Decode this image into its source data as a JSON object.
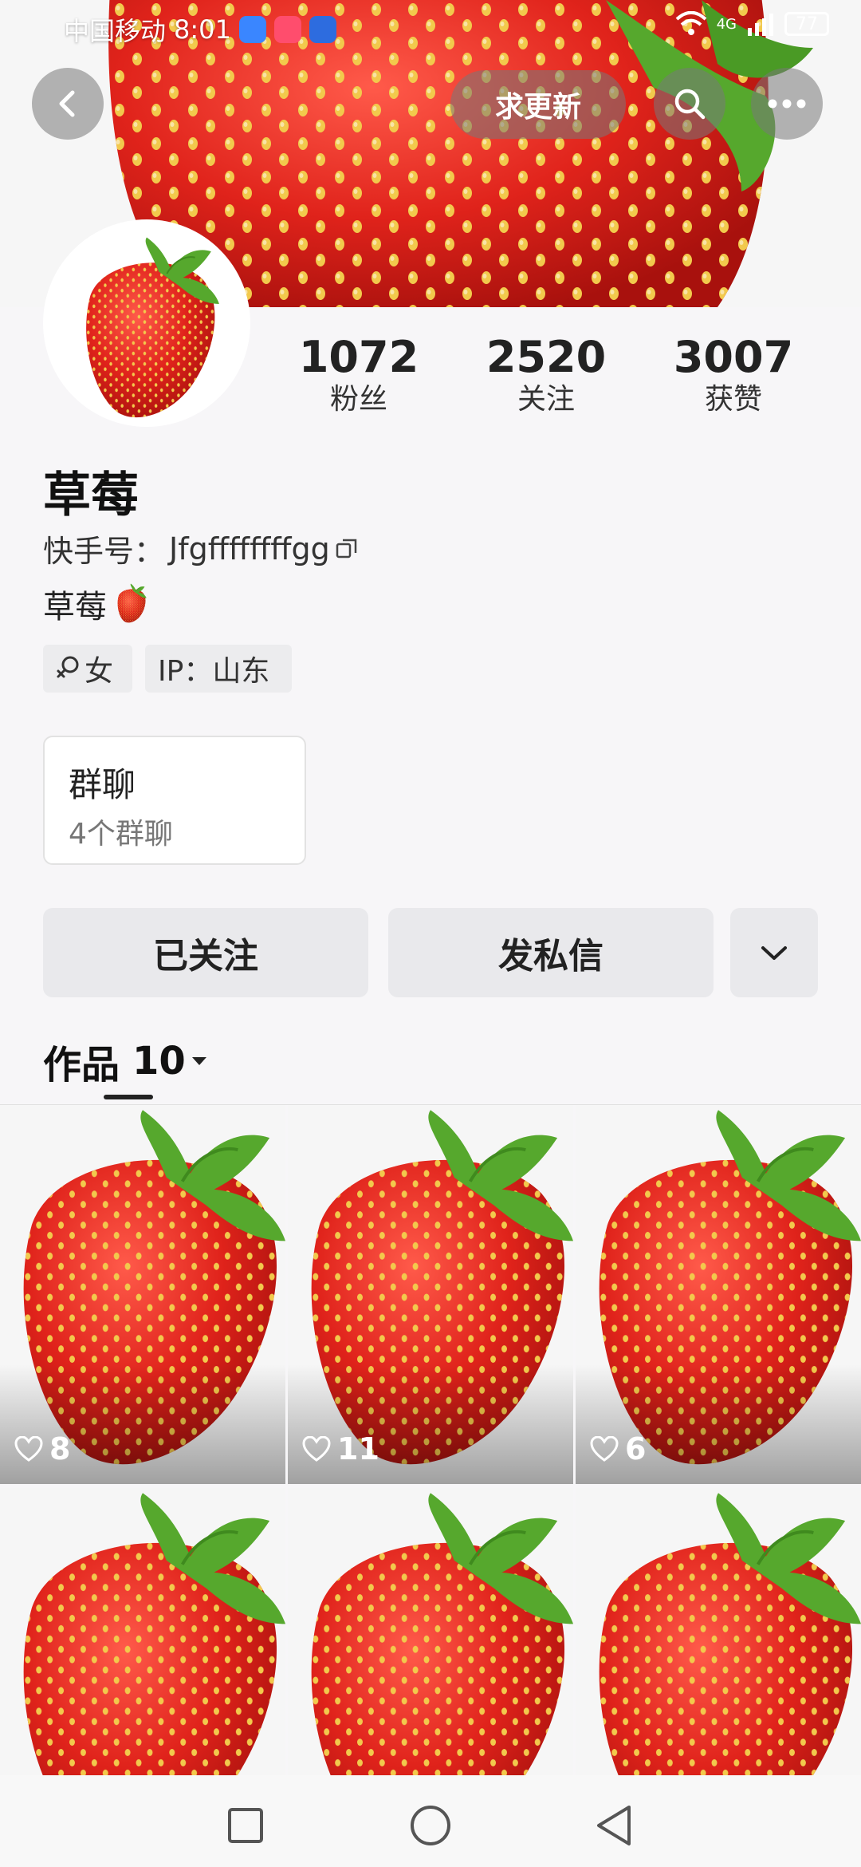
{
  "status_bar": {
    "carrier": "中国移动",
    "time": "8:01",
    "network": "4G",
    "battery": "77"
  },
  "nav": {
    "request_update_label": "求更新"
  },
  "stats": [
    {
      "value": "1072",
      "label": "粉丝"
    },
    {
      "value": "2520",
      "label": "关注"
    },
    {
      "value": "3007",
      "label": "获赞"
    }
  ],
  "profile": {
    "name": "草莓",
    "id_label": "快手号：",
    "id_value": "Jfgffffffffgg",
    "bio": "草莓",
    "tags": {
      "gender": "女",
      "ip": "IP：山东"
    }
  },
  "group_chat": {
    "title": "群聊",
    "subtitle": "4个群聊"
  },
  "actions": {
    "followed_label": "已关注",
    "message_label": "发私信"
  },
  "works": {
    "tab_label": "作品",
    "count": "10",
    "items": [
      {
        "likes": "8"
      },
      {
        "likes": "11"
      },
      {
        "likes": "6"
      },
      {
        "likes": ""
      },
      {
        "likes": ""
      },
      {
        "likes": ""
      }
    ]
  },
  "colors": {
    "strawberry_red": "#e3261e",
    "leaf_green": "#56a82d",
    "seed_yellow": "#f2c94c"
  }
}
